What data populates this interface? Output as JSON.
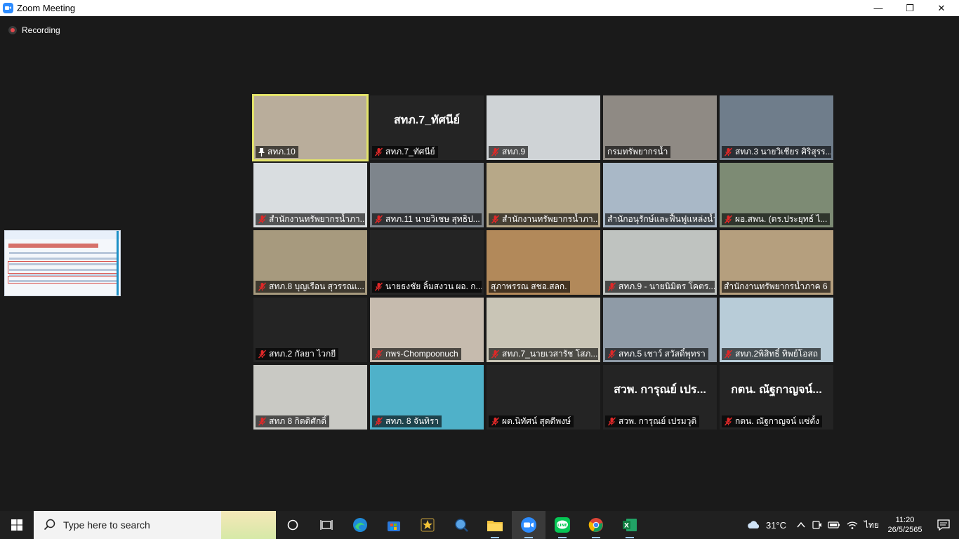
{
  "window": {
    "title": "Zoom Meeting",
    "minimize": "—",
    "restore": "❐",
    "close": "✕"
  },
  "recording": {
    "label": "Recording"
  },
  "participants": [
    {
      "label": "สทภ.10",
      "name_only": "",
      "muted": false,
      "pinned": true,
      "active": true,
      "bg": "#b9ad9b"
    },
    {
      "label": "สทภ.7_ทัศนีย์",
      "name_only": "สทภ.7_ทัศนีย์",
      "muted": true,
      "pinned": false,
      "active": false,
      "bg": "#242424"
    },
    {
      "label": "สทภ.9",
      "name_only": "",
      "muted": true,
      "pinned": false,
      "active": false,
      "bg": "#cfd3d6"
    },
    {
      "label": "กรมทรัพยากรน้ำ",
      "name_only": "",
      "muted": false,
      "pinned": false,
      "active": false,
      "bg": "#8f8a84"
    },
    {
      "label": "สทภ.3 นายวิเชียร ศิริสุรร...",
      "name_only": "",
      "muted": true,
      "pinned": false,
      "active": false,
      "bg": "#6f7d8b"
    },
    {
      "label": "สำนักงานทรัพยากรน้ำภา...",
      "name_only": "",
      "muted": true,
      "pinned": false,
      "active": false,
      "bg": "#d9dde0"
    },
    {
      "label": "สทภ.11 นายวิเชษ สุทธิป...",
      "name_only": "",
      "muted": true,
      "pinned": false,
      "active": false,
      "bg": "#7e858c"
    },
    {
      "label": "สำนักงานทรัพยากรน้ำภา...",
      "name_only": "",
      "muted": true,
      "pinned": false,
      "active": false,
      "bg": "#b7a888"
    },
    {
      "label": "สำนักอนุรักษ์และฟื้นฟูแหล่งน้ำ",
      "name_only": "",
      "muted": false,
      "pinned": false,
      "active": false,
      "bg": "#a9b8c7"
    },
    {
      "label": "ผอ.สพน. (ดร.ประยุทธ์ ไ...",
      "name_only": "",
      "muted": true,
      "pinned": false,
      "active": false,
      "bg": "#7d8b74"
    },
    {
      "label": "สทภ.8 บุญเรือน สุวรรณเ...",
      "name_only": "",
      "muted": true,
      "pinned": false,
      "active": false,
      "bg": "#a79a7e"
    },
    {
      "label": "นายธงชัย ลิ้มสงวน ผอ. ก...",
      "name_only": "",
      "muted": true,
      "pinned": false,
      "active": false,
      "bg": "#242424"
    },
    {
      "label": "สุภาพรรณ สชอ.สลก.",
      "name_only": "",
      "muted": false,
      "pinned": false,
      "active": false,
      "bg": "#b2895a"
    },
    {
      "label": "สทภ.9 - นายนิมิตร โคตร...",
      "name_only": "",
      "muted": true,
      "pinned": false,
      "active": false,
      "bg": "#bfc3c0"
    },
    {
      "label": "สำนักงานทรัพยากรน้ำภาค 6",
      "name_only": "",
      "muted": false,
      "pinned": false,
      "active": false,
      "bg": "#b59f7e"
    },
    {
      "label": "สทภ.2 กัลยา ไวกยี",
      "name_only": "",
      "muted": true,
      "pinned": false,
      "active": false,
      "bg": "#242424"
    },
    {
      "label": "กพร-Chompoonuch",
      "name_only": "",
      "muted": true,
      "pinned": false,
      "active": false,
      "bg": "#c6bbae"
    },
    {
      "label": "สทภ.7_นายเวสารัช โสภ...",
      "name_only": "",
      "muted": true,
      "pinned": false,
      "active": false,
      "bg": "#c9c5b6"
    },
    {
      "label": "สทภ.5 เชาว์ สวัสดิ์พุทรา",
      "name_only": "",
      "muted": true,
      "pinned": false,
      "active": false,
      "bg": "#8f9ba7"
    },
    {
      "label": "สทภ.2พิสิทธิ์ ทิพย์โอสถ",
      "name_only": "",
      "muted": true,
      "pinned": false,
      "active": false,
      "bg": "#b8ccd8"
    },
    {
      "label": "สทภ 8 กิตติศักดิ์",
      "name_only": "",
      "muted": true,
      "pinned": false,
      "active": false,
      "bg": "#c9c9c4"
    },
    {
      "label": "สทภ. 8 จันทิรา",
      "name_only": "",
      "muted": true,
      "pinned": false,
      "active": false,
      "bg": "#4fb1c9"
    },
    {
      "label": "ผต.นิทัศน์ สุดดีพงษ์",
      "name_only": "",
      "muted": true,
      "pinned": false,
      "active": false,
      "bg": "#242424"
    },
    {
      "label": "สวพ. การุณย์ เปรมวุติ",
      "name_only": "สวพ. การุณย์ เปร...",
      "muted": true,
      "pinned": false,
      "active": false,
      "bg": "#242424"
    },
    {
      "label": "กตน. ณัฐกาญจน์ แซ่ตั้ง",
      "name_only": "กตน. ณัฐกาญจน์...",
      "muted": true,
      "pinned": false,
      "active": false,
      "bg": "#242424"
    }
  ],
  "taskbar": {
    "search_placeholder": "Type here to search",
    "weather": "31°C",
    "language": "ไทย",
    "time": "11:20",
    "date": "26/5/2565"
  }
}
